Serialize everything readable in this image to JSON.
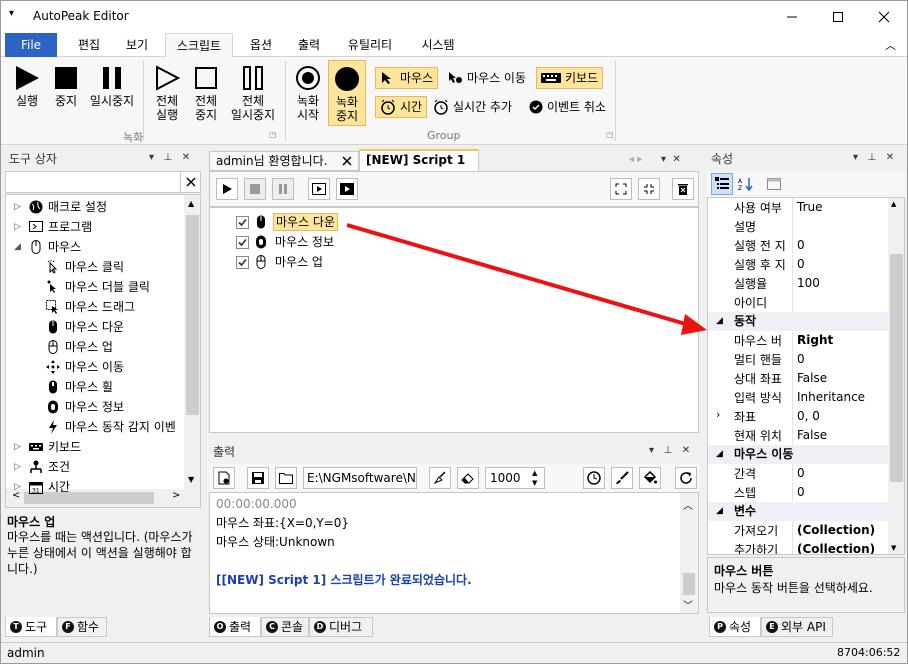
{
  "window": {
    "title": "AutoPeak Editor",
    "qa_icon": "menu-down-icon"
  },
  "ribbon_tabs": [
    {
      "label": "File"
    },
    {
      "label": "편집"
    },
    {
      "label": "보기"
    },
    {
      "label": "스크립트"
    },
    {
      "label": "옵션"
    },
    {
      "label": "출력"
    },
    {
      "label": "유틸리티"
    },
    {
      "label": "시스템"
    }
  ],
  "ribbon": {
    "run": "실행",
    "stop": "중지",
    "pause": "일시중지",
    "all_run_1": "전체",
    "all_run_2": "실행",
    "all_stop_1": "전체",
    "all_stop_2": "중지",
    "all_pause_1": "전체",
    "all_pause_2": "일시중지",
    "rec_start_1": "녹화",
    "rec_start_2": "시작",
    "rec_stop_1": "녹화",
    "rec_stop_2": "중지",
    "group1_label": "녹화",
    "mouse": "마우스",
    "mouse_move": "마우스 이동",
    "keyboard": "키보드",
    "time": "시간",
    "realtime_add": "실시간 추가",
    "event_cancel": "이벤트 취소",
    "group2_label": "Group"
  },
  "toolbox": {
    "title": "도구 상자",
    "search_value": "",
    "items": [
      {
        "label": "매크로 설정",
        "level": 0,
        "arrow": "▷",
        "icon": "globe-icon"
      },
      {
        "label": "프로그램",
        "level": 0,
        "arrow": "▷",
        "icon": "program-icon"
      },
      {
        "label": "마우스",
        "level": 0,
        "arrow": "◢",
        "icon": "mouse-icon"
      },
      {
        "label": "마우스 클릭",
        "level": 1,
        "icon": "mouse-click-icon"
      },
      {
        "label": "마우스 더블 클릭",
        "level": 1,
        "icon": "mouse-double-click-icon"
      },
      {
        "label": "마우스 드래그",
        "level": 1,
        "icon": "mouse-drag-icon"
      },
      {
        "label": "마우스 다운",
        "level": 1,
        "icon": "mouse-down-icon"
      },
      {
        "label": "마우스 업",
        "level": 1,
        "icon": "mouse-up-icon"
      },
      {
        "label": "마우스 이동",
        "level": 1,
        "icon": "move-icon"
      },
      {
        "label": "마우스 휠",
        "level": 1,
        "icon": "mouse-wheel-icon"
      },
      {
        "label": "마우스 정보",
        "level": 1,
        "icon": "mouse-info-icon"
      },
      {
        "label": "마우스 동작 감지 이벤",
        "level": 1,
        "icon": "lightning-icon"
      },
      {
        "label": "키보드",
        "level": 0,
        "arrow": "▷",
        "icon": "keyboard-icon"
      },
      {
        "label": "조건",
        "level": 0,
        "arrow": "▷",
        "icon": "condition-icon"
      },
      {
        "label": "시간",
        "level": 0,
        "arrow": "▷",
        "icon": "calendar-icon"
      }
    ],
    "desc_title": "마우스 업",
    "desc_text": "마우스를 때는 액션입니다. (마우스가 누른 상태에서 이 액션을 실행해야 합니다.)",
    "tabs": [
      {
        "label": "도구",
        "badge": "T"
      },
      {
        "label": "함수",
        "badge": "F"
      }
    ]
  },
  "editor": {
    "tabs": [
      {
        "label": "admin님 환영합니다."
      },
      {
        "label": "[NEW] Script 1"
      }
    ],
    "lines": [
      {
        "label": "마우스 다운",
        "checked": true,
        "icon": "mouse-down-icon",
        "selected": true
      },
      {
        "label": "마우스 정보",
        "checked": true,
        "icon": "mouse-info-icon"
      },
      {
        "label": "마우스 업",
        "checked": true,
        "icon": "mouse-up-icon"
      }
    ]
  },
  "output": {
    "title": "출력",
    "path": "E:\\NGMsoftware\\NG",
    "delay": "1000",
    "lines": [
      {
        "text": "00:00:00.000",
        "style": "time"
      },
      {
        "text": "마우스 좌표:{X=0,Y=0}",
        "style": "normal"
      },
      {
        "text": "마우스 상태:Unknown",
        "style": "normal"
      },
      {
        "text": "",
        "style": "normal"
      },
      {
        "text": "[[NEW] Script 1] 스크립트가 완료되었습니다.",
        "style": "done"
      }
    ],
    "tabs": [
      {
        "label": "출력",
        "badge": "O"
      },
      {
        "label": "콘솔",
        "badge": "C"
      },
      {
        "label": "디버그",
        "badge": "D"
      }
    ]
  },
  "properties": {
    "title": "속성",
    "rows": [
      {
        "type": "row",
        "key": "사용 여부",
        "value": "True"
      },
      {
        "type": "row",
        "key": "설명",
        "value": ""
      },
      {
        "type": "row",
        "key": "실행 전 지",
        "value": "0"
      },
      {
        "type": "row",
        "key": "실행 후 지",
        "value": "0"
      },
      {
        "type": "row",
        "key": "실행율",
        "value": "100"
      },
      {
        "type": "row",
        "key": "아이디",
        "value": ""
      },
      {
        "type": "cat",
        "key": "동작"
      },
      {
        "type": "row",
        "key": "마우스 버",
        "value": "Right",
        "bold": true
      },
      {
        "type": "row",
        "key": "멀티 핸들",
        "value": "0"
      },
      {
        "type": "row",
        "key": "상대 좌표",
        "value": "False"
      },
      {
        "type": "row",
        "key": "입력 방식",
        "value": "Inheritance"
      },
      {
        "type": "row",
        "key": "좌표",
        "value": "0, 0",
        "expand": true
      },
      {
        "type": "row",
        "key": "현재 위치",
        "value": "False"
      },
      {
        "type": "cat",
        "key": "마우스 이동"
      },
      {
        "type": "row",
        "key": "간격",
        "value": "0"
      },
      {
        "type": "row",
        "key": "스텝",
        "value": "0"
      },
      {
        "type": "cat",
        "key": "변수"
      },
      {
        "type": "row",
        "key": "가져오기",
        "value": "(Collection)",
        "bold": true
      },
      {
        "type": "row",
        "key": "추가하기",
        "value": "(Collection)",
        "bold": true
      }
    ],
    "desc_title": "마우스 버튼",
    "desc_text": "마우스 동작 버튼을 선택하세요.",
    "tabs": [
      {
        "label": "속성",
        "badge": "P"
      },
      {
        "label": "외부 API",
        "badge": "E"
      }
    ]
  },
  "status": {
    "user": "admin",
    "clock": "8704:06:52"
  }
}
